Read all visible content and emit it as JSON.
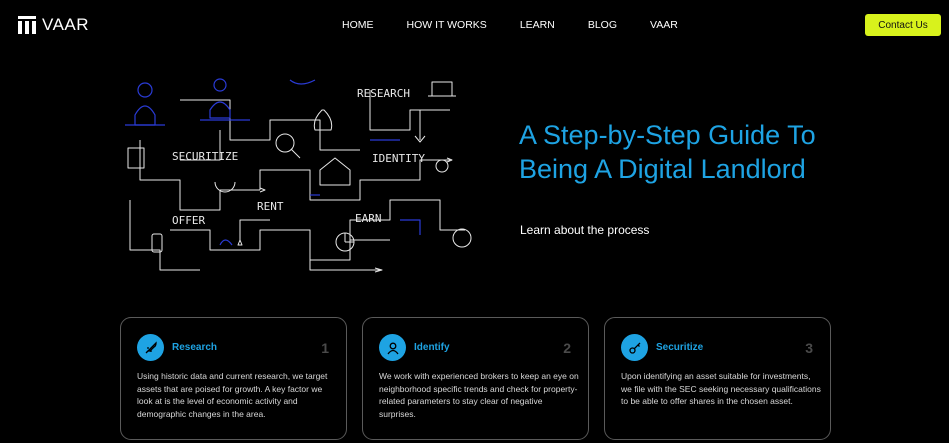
{
  "brand": {
    "name": "VAAR"
  },
  "nav": {
    "items": [
      "HOME",
      "HOW IT WORKS",
      "LEARN",
      "BLOG",
      "VAAR"
    ],
    "cta": "Contact Us"
  },
  "hero": {
    "title": "A Step-by-Step Guide To Being A Digital Landlord",
    "subtitle": "Learn about the process",
    "illustration_labels": [
      "RESEARCH",
      "SECURITIZE",
      "IDENTITY",
      "OFFER",
      "RENT",
      "EARN"
    ]
  },
  "steps": [
    {
      "title": "Research",
      "number": "1",
      "icon": "rocket-icon",
      "text": "Using historic data and current research, we target assets that are poised for growth. A key factor we look at is the level of economic activity and demographic changes in the area."
    },
    {
      "title": "Identify",
      "number": "2",
      "icon": "user-icon",
      "text": "We work with experienced brokers to keep an eye on neighborhood specific trends and check for property-related parameters to stay clear of negative surprises."
    },
    {
      "title": "Securitize",
      "number": "3",
      "icon": "key-icon",
      "text": "Upon identifying an asset suitable for investments, we file with the SEC seeking necessary qualifications to be able to offer shares in the chosen asset."
    }
  ],
  "colors": {
    "accent": "#1ea3e3",
    "cta": "#d8f21c",
    "background": "#000000"
  }
}
